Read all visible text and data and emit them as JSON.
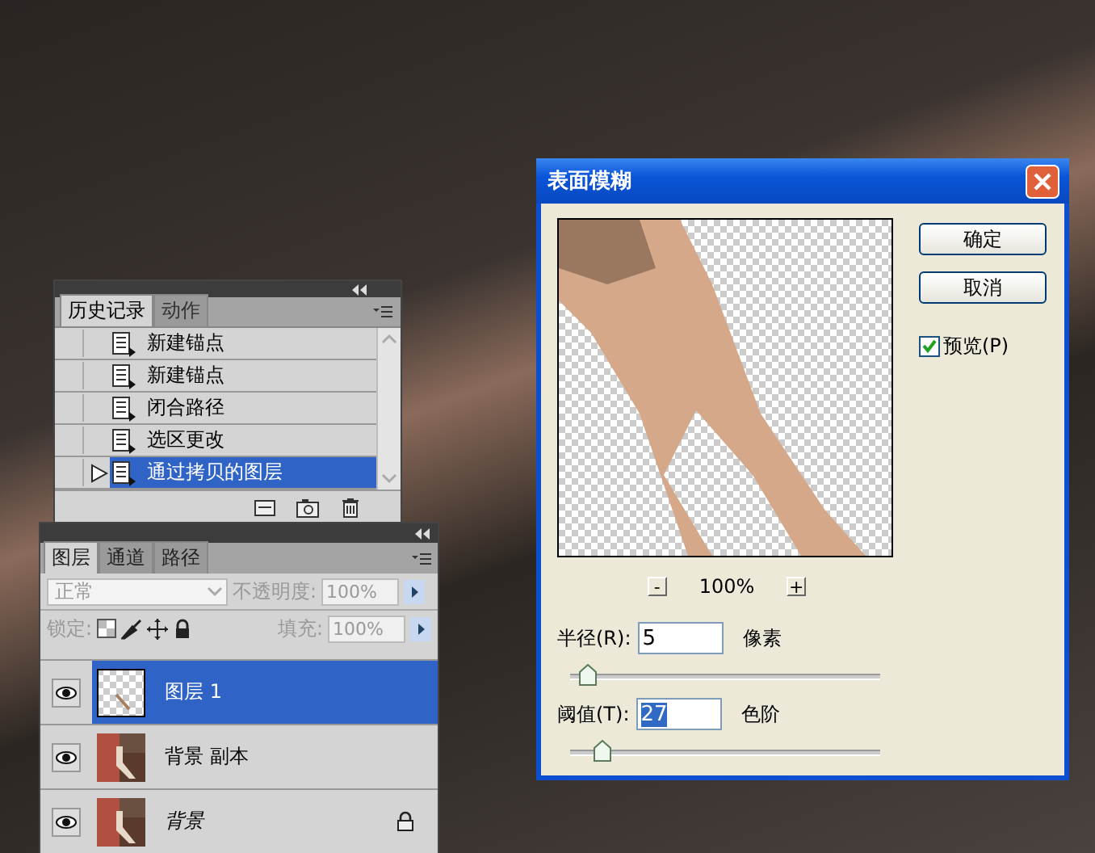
{
  "history_panel": {
    "tabs": [
      {
        "label": "历史记录",
        "selected": true
      },
      {
        "label": "动作",
        "selected": false
      }
    ],
    "items": [
      {
        "label": "新建锚点",
        "selected": false
      },
      {
        "label": "新建锚点",
        "selected": false
      },
      {
        "label": "闭合路径",
        "selected": false
      },
      {
        "label": "选区更改",
        "selected": false
      },
      {
        "label": "通过拷贝的图层",
        "selected": true
      }
    ]
  },
  "layers_panel": {
    "tabs": [
      {
        "label": "图层",
        "selected": true
      },
      {
        "label": "通道",
        "selected": false
      },
      {
        "label": "路径",
        "selected": false
      }
    ],
    "blend_mode": {
      "value": "正常",
      "disabled": true
    },
    "opacity": {
      "label": "不透明度:",
      "value": "100%",
      "disabled": true
    },
    "lock": {
      "label": "锁定:",
      "disabled": true
    },
    "fill": {
      "label": "填充:",
      "value": "100%",
      "disabled": true
    },
    "layers": [
      {
        "name": "图层 1",
        "kind": "transparent",
        "selected": true,
        "visible": true,
        "locked": false
      },
      {
        "name": "背景 副本",
        "kind": "photo",
        "selected": false,
        "visible": true,
        "locked": false
      },
      {
        "name": "背景",
        "kind": "background",
        "selected": false,
        "visible": true,
        "locked": true
      }
    ]
  },
  "dialog": {
    "title": "表面模糊",
    "buttons": [
      "确定",
      "取消"
    ],
    "preview": {
      "label": "预览(P)",
      "checked": true
    },
    "zoom": {
      "minus": "-",
      "value": "100%",
      "plus": "+"
    },
    "params": [
      {
        "label": "半径(R):",
        "value": "5",
        "unit": "像素",
        "level": 0.05,
        "selected": false
      },
      {
        "label": "阈值(T):",
        "value": "27",
        "unit": "色阶",
        "level": 0.1,
        "selected": true
      }
    ]
  }
}
